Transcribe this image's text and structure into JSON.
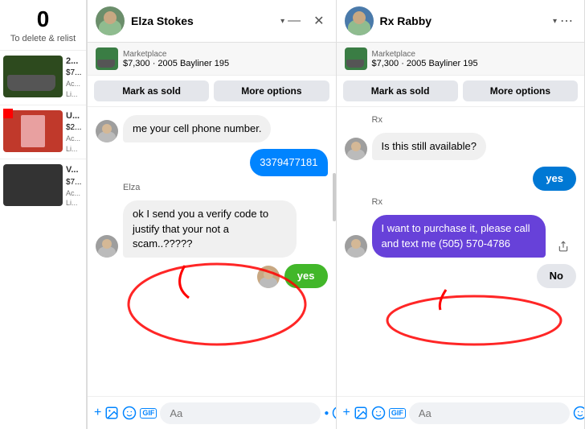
{
  "sidebar": {
    "count": "0",
    "delete_relist": "To delete & relist"
  },
  "leftPanel": {
    "header": {
      "name": "Elza Stokes",
      "chevron": "▾"
    },
    "listing": {
      "source": "Marketplace",
      "description": "$7,300 · 2005 Bayliner 195"
    },
    "actions": {
      "mark_sold": "Mark as sold",
      "more_options": "More options"
    },
    "messages": [
      {
        "type": "received",
        "text": "me your cell phone number.",
        "sender": ""
      },
      {
        "type": "sent",
        "text": "3379477181",
        "style": "blue"
      },
      {
        "type": "sender_label",
        "text": "Elza"
      },
      {
        "type": "received",
        "text": "ok I send you a verify code to justify that your not a scam..?????",
        "sender": "elza"
      },
      {
        "type": "sent",
        "text": "yes",
        "style": "green"
      }
    ],
    "input": {
      "placeholder": "Aa"
    }
  },
  "rightPanel": {
    "header": {
      "name": "Rx Rabby",
      "chevron": "▾"
    },
    "listing": {
      "source": "Marketplace",
      "description": "$7,300 · 2005 Bayliner 195"
    },
    "actions": {
      "mark_sold": "Mark as sold",
      "more_options": "More options"
    },
    "messages": [
      {
        "type": "sender_label",
        "text": "Rx"
      },
      {
        "type": "received",
        "text": "Is this still available?",
        "sender": "rx"
      },
      {
        "type": "sent",
        "text": "yes",
        "style": "blue"
      },
      {
        "type": "sender_label",
        "text": "Rx"
      },
      {
        "type": "received_purple",
        "text": "I want to purchase it, please call and text me (505) 570-4786"
      },
      {
        "type": "sent_no",
        "text": "No",
        "style": "gray"
      }
    ],
    "input": {
      "placeholder": "Aa"
    }
  },
  "icons": {
    "minimize": "—",
    "close": "✕",
    "add": "+",
    "image": "🖼",
    "sticker": "🙂",
    "gif": "GIF",
    "emoji": "😊",
    "like": "👍",
    "more": "•••",
    "dots": "⋯"
  }
}
